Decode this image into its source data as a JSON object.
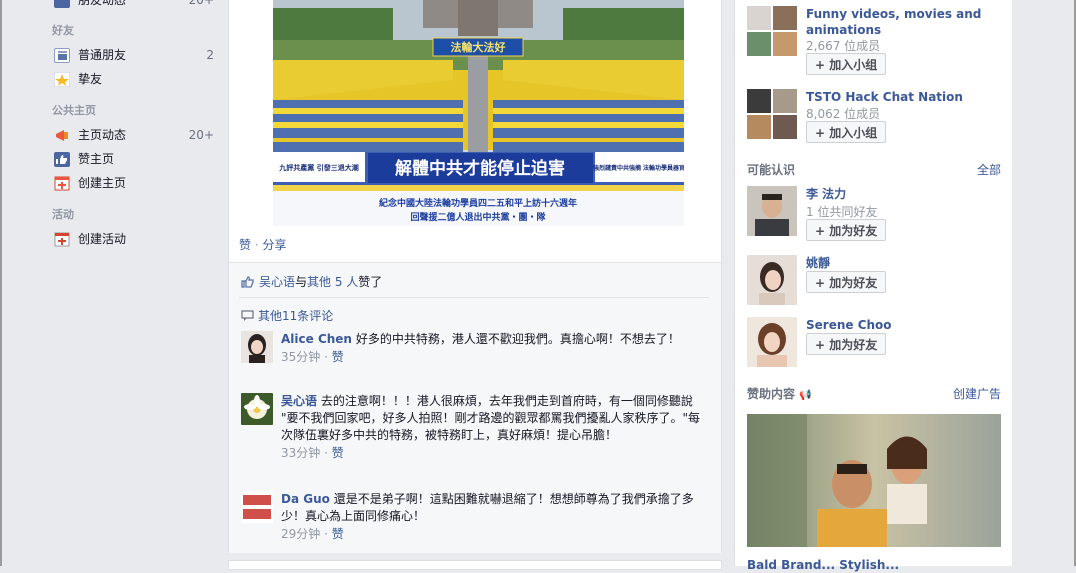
{
  "leftnav": {
    "top_item": {
      "label": "朋友动态",
      "count": "20+"
    },
    "friends_heading": "好友",
    "friends": [
      {
        "label": "普通朋友",
        "count": "2"
      },
      {
        "label": "挚友",
        "count": ""
      }
    ],
    "pages_heading": "公共主页",
    "pages": [
      {
        "label": "主页动态",
        "count": "20+"
      },
      {
        "label": "赞主页",
        "count": ""
      },
      {
        "label": "创建主页",
        "count": ""
      }
    ],
    "events_heading": "活动",
    "events": [
      {
        "label": "创建活动",
        "count": ""
      }
    ]
  },
  "post": {
    "photo": {
      "banner_top": "法輪大法好",
      "banner_main": "解體中共才能停止迫害",
      "side_left": "九評共產黨 引發三退大潮",
      "side_right": "強烈譴責中共強摘 法輪功學員器官",
      "bottom_1": "紀念中國大陸法輪功學員四二五和平上訪十六週年",
      "bottom_2": "回聲援二億人退出中共黨・團・隊"
    },
    "actions": {
      "like": "赞",
      "separator": " · ",
      "share": "分享"
    },
    "likes": {
      "name": "吴心语",
      "conj": "与",
      "others": "其他 5 人",
      "suffix": "赞了"
    },
    "more_comments": "其他11条评论",
    "comments": [
      {
        "name": "Alice Chen",
        "text": "好多的中共特務，港人還不歡迎我們。真擔心啊！不想去了！",
        "time": "35分钟",
        "like": "赞"
      },
      {
        "name": "吴心语",
        "text": "去的注意啊！！！港人很麻煩，去年我們走到首府時，有一個同修聽說 \"要不我們回家吧，好多人拍照！剛才路邊的觀眾都罵我們擾亂人家秩序了。\"每次隊伍裏好多中共的特務，被特務盯上，真好麻煩！提心吊膽！",
        "time": "33分钟",
        "like": "赞"
      },
      {
        "name": "Da Guo",
        "text": "還是不是弟子啊！這點困難就嚇退縮了！想想師尊為了我們承擔了多少！真心為上面同修痛心！",
        "time": "29分钟",
        "like": "赞"
      }
    ]
  },
  "sidebar": {
    "groups": [
      {
        "title": "Funny videos, movies and animations",
        "members": "2,667 位成员",
        "button": "加入小组"
      },
      {
        "title": "TSTO Hack Chat Nation",
        "members": "8,062 位成员",
        "button": "加入小组"
      }
    ],
    "pymk": {
      "heading": "可能认识",
      "see_all": "全部",
      "people": [
        {
          "name": "李 法力",
          "mutual": "1 位共同好友",
          "button": "加为好友"
        },
        {
          "name": "姚靜",
          "mutual": "",
          "button": "加为好友"
        },
        {
          "name": "Serene Choo",
          "mutual": "",
          "button": "加为好友"
        }
      ]
    },
    "sponsored": {
      "heading": "赞助内容",
      "create_ad": "创建广告",
      "ad_title_partial": "Bald Brand... Stylish..."
    }
  },
  "colors": {
    "link": "#3b5998",
    "background": "#e9eaed",
    "muted": "#9197a3"
  }
}
